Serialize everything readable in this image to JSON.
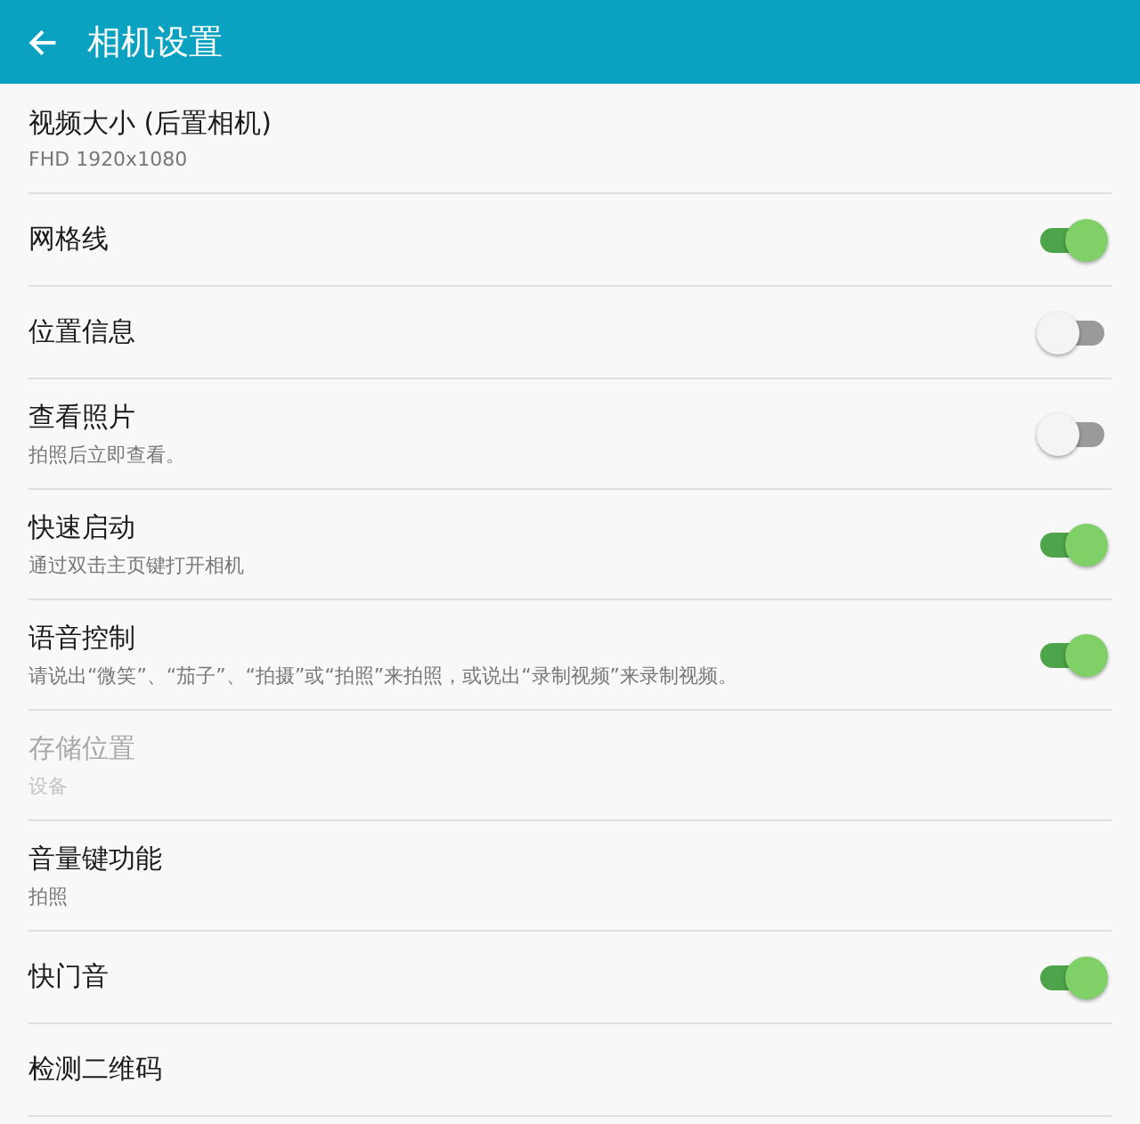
{
  "header": {
    "title": "相机设置"
  },
  "settings": [
    {
      "kind": "plain",
      "title": "视频大小 (后置相机)",
      "summary": "FHD 1920x1080",
      "disabled": false
    },
    {
      "kind": "toggle",
      "title": "网格线",
      "on": true,
      "disabled": false
    },
    {
      "kind": "toggle",
      "title": "位置信息",
      "on": false,
      "disabled": false
    },
    {
      "kind": "toggle",
      "title": "查看照片",
      "summary": "拍照后立即查看。",
      "on": false,
      "disabled": false
    },
    {
      "kind": "toggle",
      "title": "快速启动",
      "summary": "通过双击主页键打开相机",
      "on": true,
      "disabled": false
    },
    {
      "kind": "toggle",
      "title": "语音控制",
      "summary": "请说出“微笑”、“茄子”、“拍摄”或“拍照”来拍照，或说出“录制视频”来录制视频。",
      "on": true,
      "disabled": false
    },
    {
      "kind": "plain",
      "title": "存储位置",
      "summary": "设备",
      "disabled": true
    },
    {
      "kind": "plain",
      "title": "音量键功能",
      "summary": "拍照",
      "disabled": false
    },
    {
      "kind": "toggle",
      "title": "快门音",
      "on": true,
      "disabled": false
    },
    {
      "kind": "plain",
      "title": "检测二维码",
      "disabled": false
    }
  ]
}
